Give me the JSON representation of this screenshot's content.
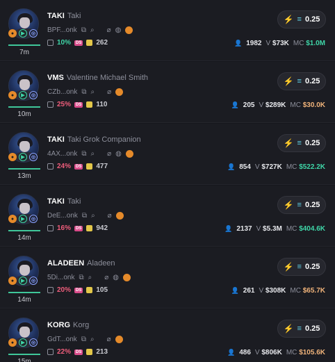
{
  "tokens": [
    {
      "ticker": "TAKI",
      "name": "Taki",
      "address": "BPF...onk",
      "age": "7m",
      "pct": "10%",
      "pct_color": "green",
      "holders": "262",
      "buy": "0.25",
      "people": "1982",
      "volume": "$73K",
      "mc": "$1.0M",
      "mc_color": "green",
      "extra_icons": true
    },
    {
      "ticker": "VMS",
      "name": "Valentine Michael Smith",
      "address": "CZb...onk",
      "age": "10m",
      "pct": "25%",
      "pct_color": "red",
      "holders": "110",
      "buy": "0.25",
      "people": "205",
      "volume": "$289K",
      "mc": "$30.0K",
      "mc_color": "orange",
      "extra_icons": false
    },
    {
      "ticker": "TAKI",
      "name": "Taki Grok Companion",
      "address": "4AX...onk",
      "age": "13m",
      "pct": "24%",
      "pct_color": "red",
      "holders": "477",
      "buy": "0.25",
      "people": "854",
      "volume": "$727K",
      "mc": "$522.2K",
      "mc_color": "green",
      "extra_icons": true
    },
    {
      "ticker": "TAKI",
      "name": "Taki",
      "address": "DeE...onk",
      "age": "14m",
      "pct": "16%",
      "pct_color": "red",
      "holders": "942",
      "buy": "0.25",
      "people": "2137",
      "volume": "$5.3M",
      "mc": "$404.6K",
      "mc_color": "green",
      "extra_icons": false
    },
    {
      "ticker": "ALADEEN",
      "name": "Aladeen",
      "address": "5Di...onk",
      "age": "14m",
      "pct": "20%",
      "pct_color": "red",
      "holders": "105",
      "buy": "0.25",
      "people": "261",
      "volume": "$308K",
      "mc": "$65.7K",
      "mc_color": "orange",
      "extra_icons": true
    },
    {
      "ticker": "KORG",
      "name": "Korg",
      "address": "GdT...onk",
      "age": "15m",
      "pct": "22%",
      "pct_color": "red",
      "holders": "213",
      "buy": "0.25",
      "people": "486",
      "volume": "$806K",
      "mc": "$105.6K",
      "mc_color": "orange",
      "extra_icons": false
    }
  ],
  "labels": {
    "volume": "V",
    "mc": "MC",
    "ds": "DS"
  },
  "icons": {
    "copy": "copy-icon",
    "search": "search-icon",
    "link": "link-icon",
    "globe": "globe-icon",
    "pump": "pump-icon",
    "bolt": "lightning-icon",
    "holders": "holders-icon",
    "person": "person-icon"
  },
  "colors": {
    "green": "#3fd6a8",
    "red": "#ef5d7b",
    "orange": "#f0b37a",
    "teal": "#5fd0e6"
  }
}
